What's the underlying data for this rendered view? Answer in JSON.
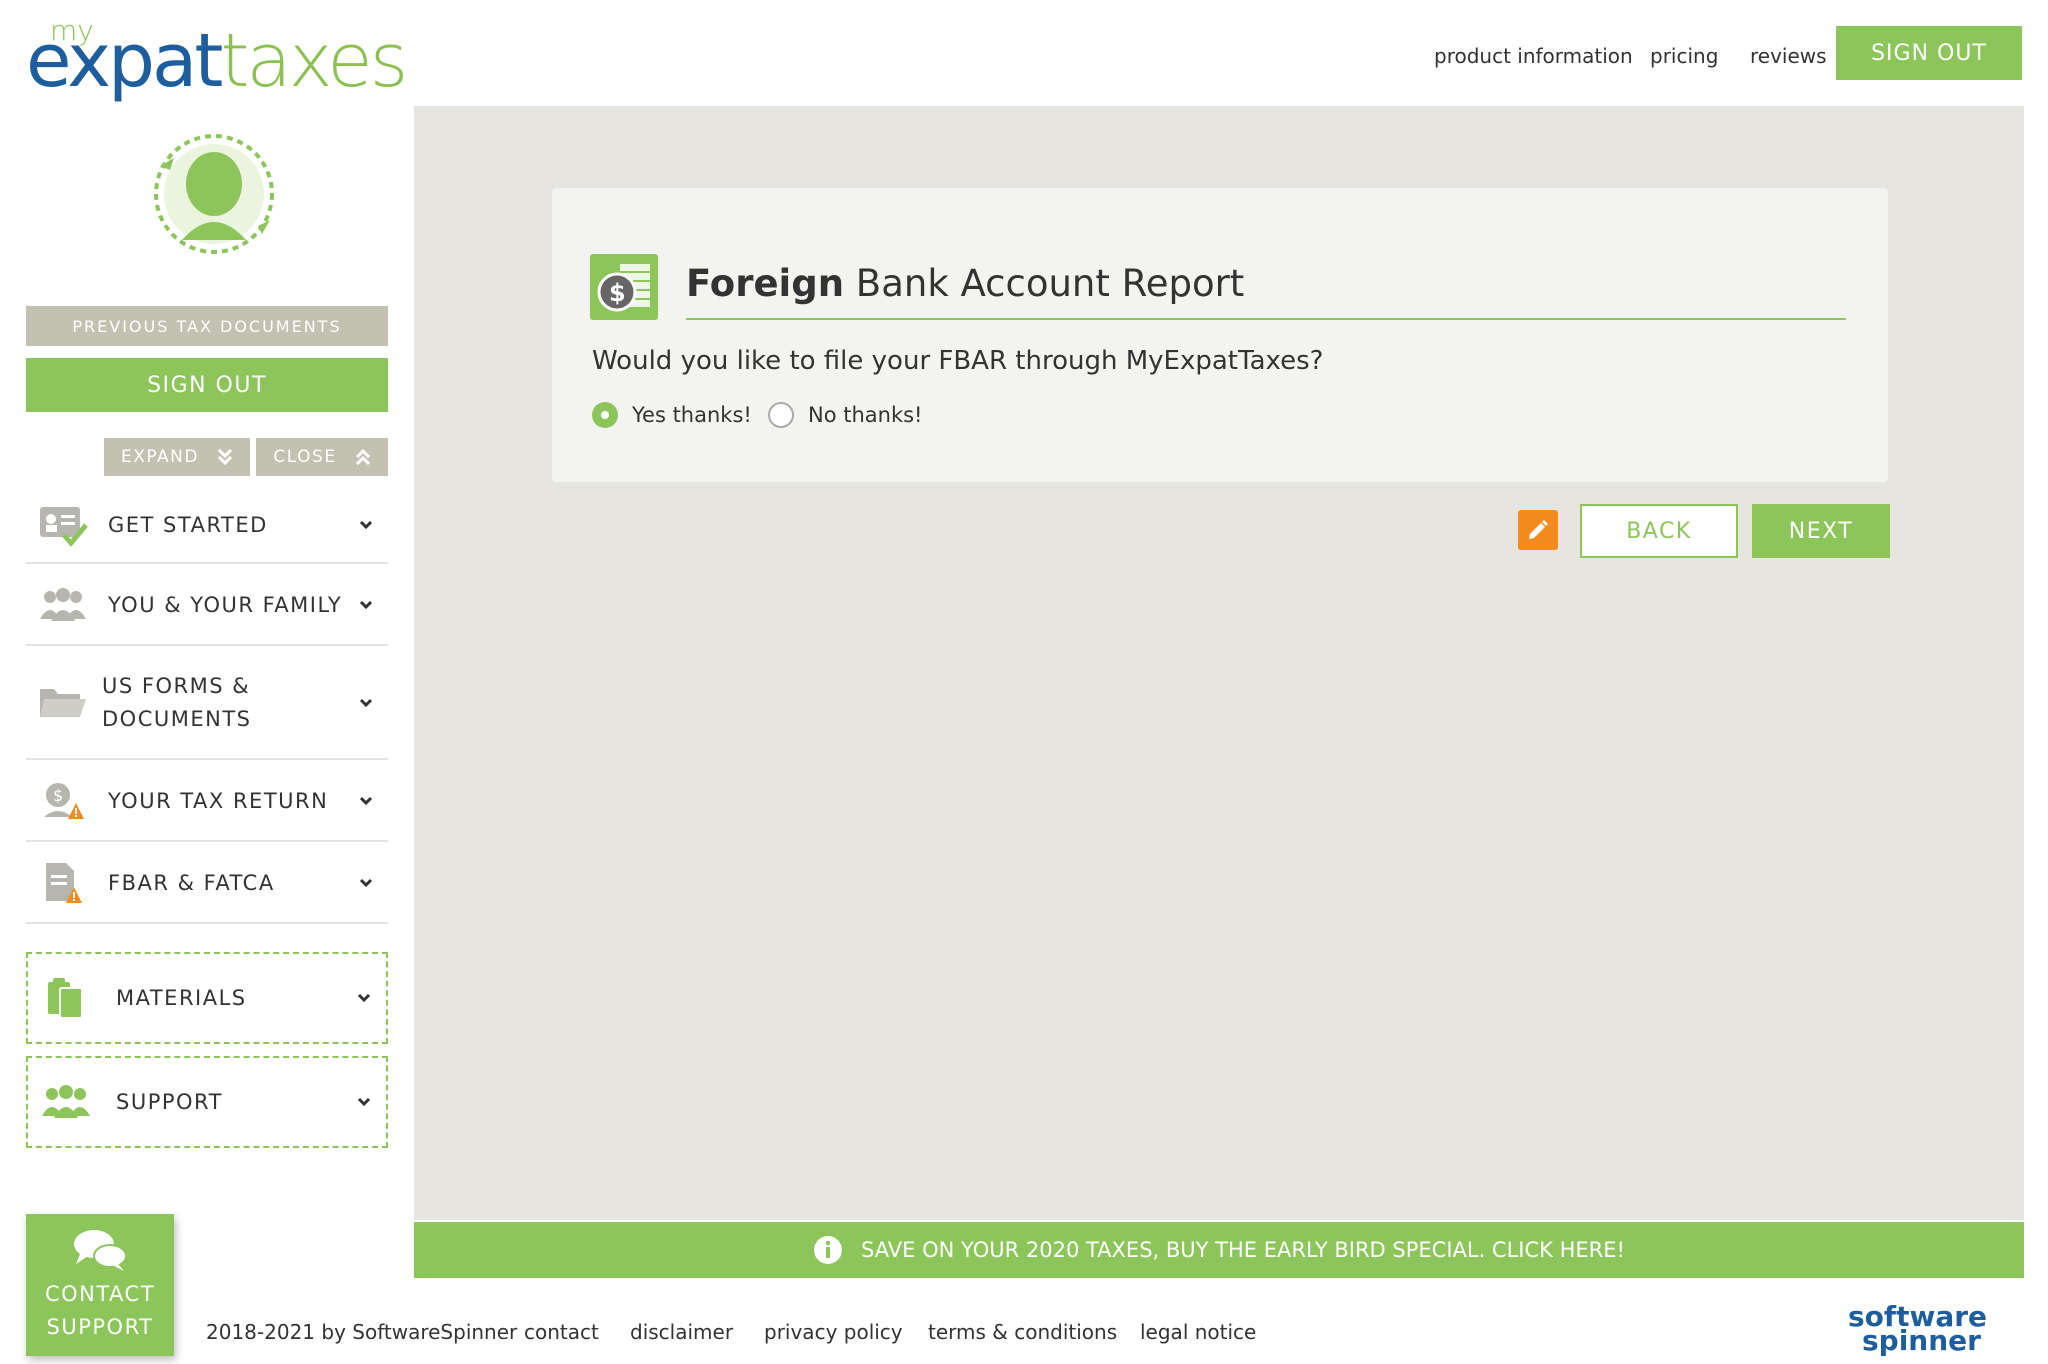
{
  "brand": {
    "logo_prefix": "my",
    "logo_part1": "expat",
    "logo_part2": "taxes",
    "primary_color": "#8cc65a",
    "logo_blue": "#1f5e9e",
    "accent_orange": "#f58a1f"
  },
  "topnav": {
    "links": [
      "product information",
      "pricing",
      "reviews"
    ],
    "signout_label": "SIGN OUT"
  },
  "sidebar": {
    "avatar_icon": "user-globe-icon",
    "previous_docs_label": "PREVIOUS TAX DOCUMENTS",
    "signout_label": "SIGN OUT",
    "expand_label": "EXPAND",
    "close_label": "CLOSE",
    "items": [
      {
        "label": "GET STARTED",
        "icon": "id-card-check-icon"
      },
      {
        "label": "YOU & YOUR FAMILY",
        "icon": "family-icon"
      },
      {
        "label_line1": "US FORMS &",
        "label_line2": "DOCUMENTS",
        "icon": "folder-icon"
      },
      {
        "label": "YOUR TAX RETURN",
        "icon": "tax-return-warning-icon"
      },
      {
        "label": "FBAR & FATCA",
        "icon": "document-warning-icon"
      }
    ],
    "boxed_items": [
      {
        "label": "MATERIALS",
        "icon": "clipboard-icon"
      },
      {
        "label": "SUPPORT",
        "icon": "group-icon"
      }
    ],
    "contact_support": {
      "line1": "CONTACT",
      "line2": "SUPPORT",
      "icon": "chat-bubbles-icon"
    }
  },
  "card": {
    "icon": "dollar-coin-stack-icon",
    "title_bold": "Foreign",
    "title_rest": " Bank Account Report",
    "question": "Would you like to file your FBAR through MyExpatTaxes?",
    "options": [
      {
        "label": "Yes thanks!",
        "selected": true
      },
      {
        "label": "No thanks!",
        "selected": false
      }
    ]
  },
  "actions": {
    "edit_icon": "pencil-icon",
    "back_label": "BACK",
    "next_label": "NEXT"
  },
  "promo": {
    "icon": "info-icon",
    "text": "SAVE ON YOUR 2020 TAXES, BUY THE EARLY BIRD SPECIAL. CLICK HERE!"
  },
  "footer": {
    "copyright": "2018-2021 by SoftwareSpinner",
    "links": [
      "contact",
      "disclaimer",
      "privacy policy",
      "terms & conditions",
      "legal notice"
    ],
    "partner_logo_line1": "software",
    "partner_logo_line2": "spinner"
  }
}
